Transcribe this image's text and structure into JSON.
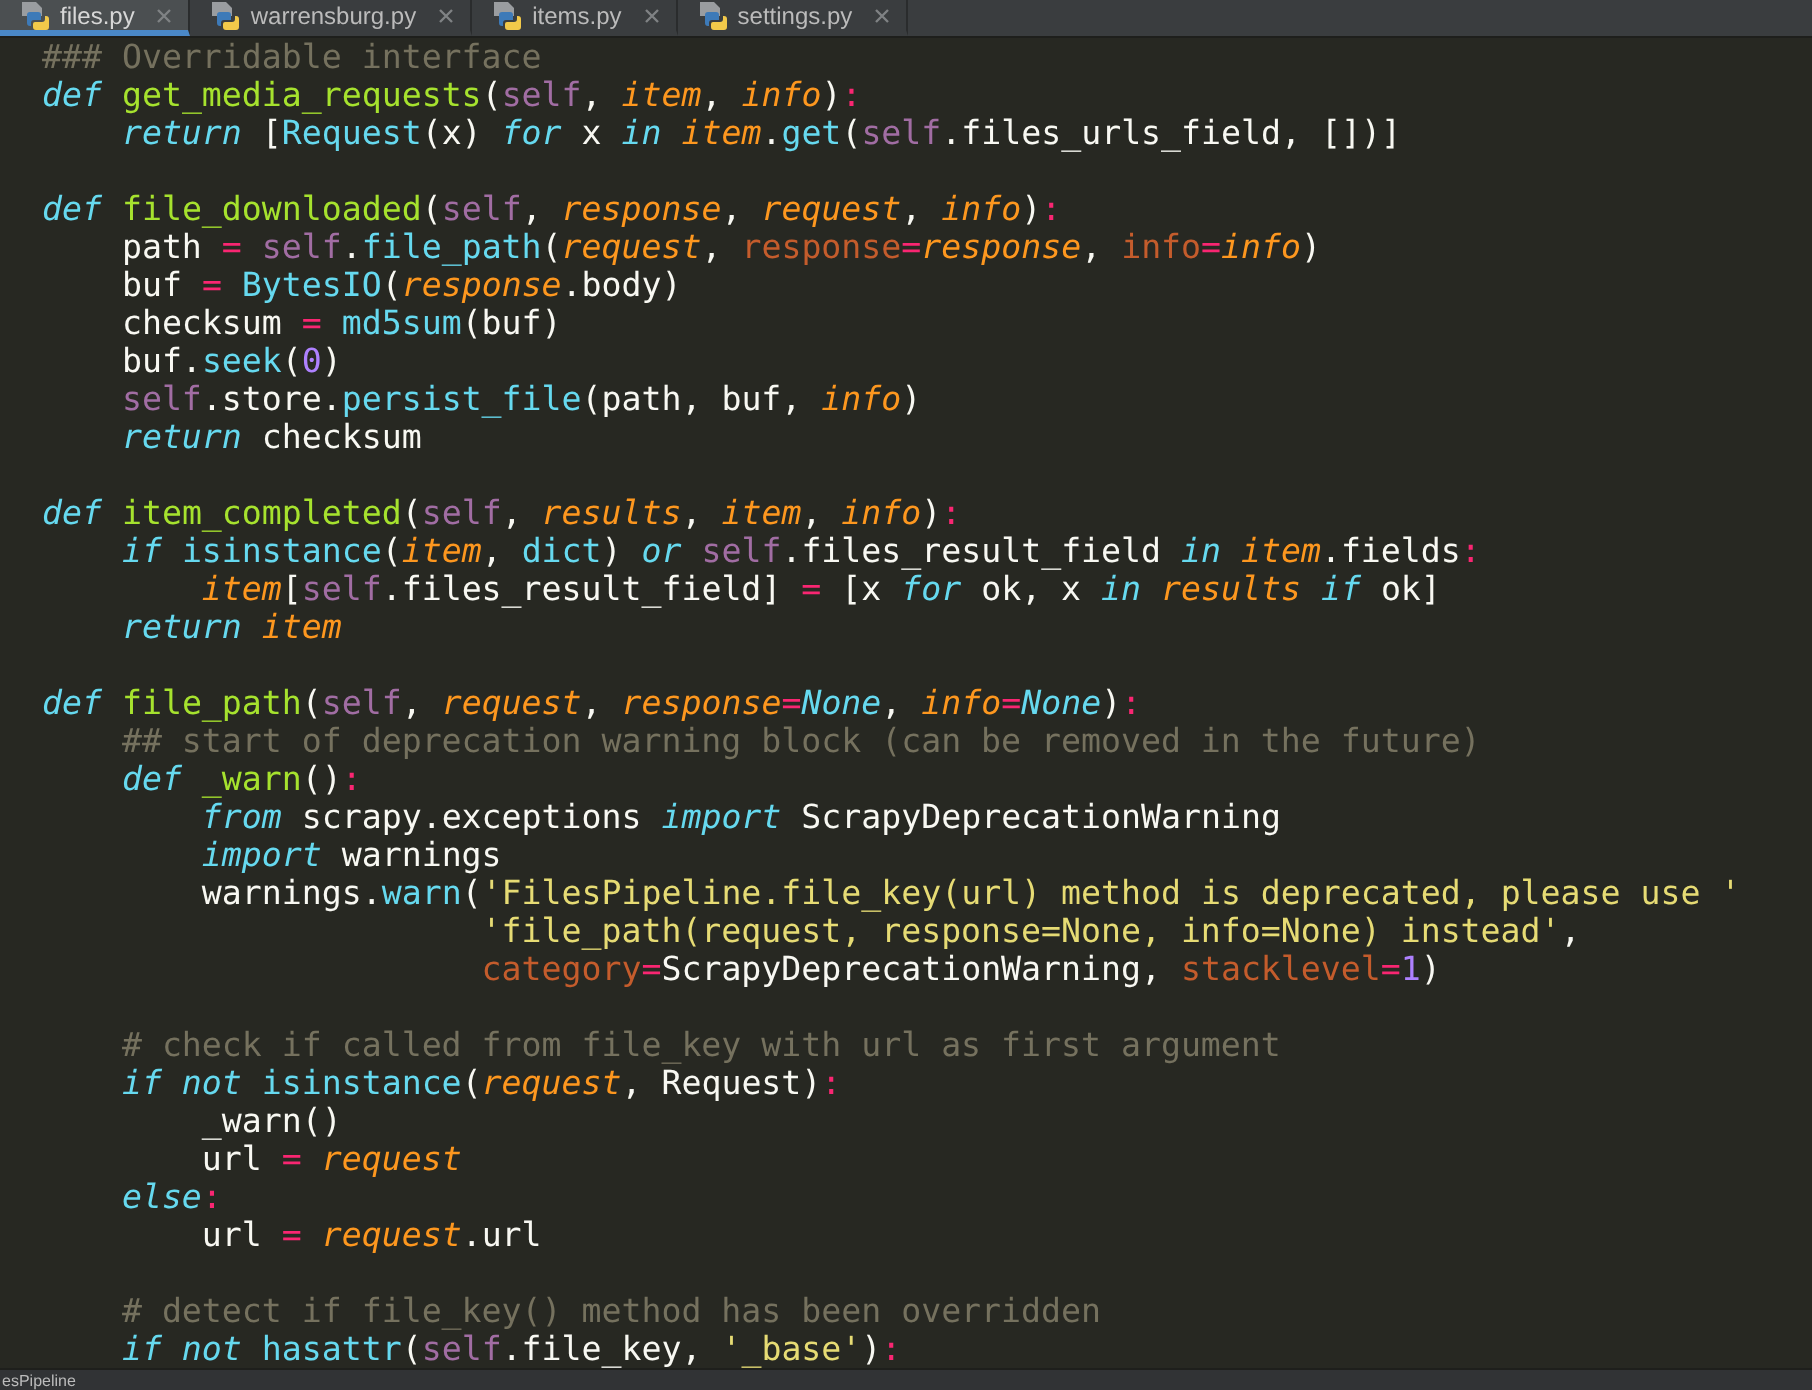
{
  "tabs": [
    {
      "label": "files.py",
      "selected": true
    },
    {
      "label": "warrensburg.py",
      "selected": false
    },
    {
      "label": "items.py",
      "selected": false
    },
    {
      "label": "settings.py",
      "selected": false
    }
  ],
  "code_lines": [
    {
      "kind": "code",
      "tokens": [
        {
          "kind": "comment",
          "text": "### Overridable interface"
        }
      ]
    },
    {
      "kind": "code",
      "tokens": [
        {
          "kind": "keyword",
          "text": "def"
        },
        {
          "kind": "function",
          "text": " get_media_requests"
        },
        {
          "kind": "plain",
          "text": "("
        },
        {
          "kind": "self",
          "text": "self"
        },
        {
          "kind": "plain",
          "text": ", "
        },
        {
          "kind": "param",
          "text": "item"
        },
        {
          "kind": "plain",
          "text": ", "
        },
        {
          "kind": "param",
          "text": "info"
        },
        {
          "kind": "plain",
          "text": ")"
        },
        {
          "kind": "operator",
          "text": ":"
        }
      ]
    },
    {
      "kind": "code",
      "tokens": [
        {
          "kind": "keyword",
          "text": "    return"
        },
        {
          "kind": "plain",
          "text": " ["
        },
        {
          "kind": "call",
          "text": "Request"
        },
        {
          "kind": "plain",
          "text": "(x) "
        },
        {
          "kind": "keyword",
          "text": "for"
        },
        {
          "kind": "plain",
          "text": " x "
        },
        {
          "kind": "keyword",
          "text": "in"
        },
        {
          "kind": "param",
          "text": " item"
        },
        {
          "kind": "plain",
          "text": "."
        },
        {
          "kind": "call",
          "text": "get"
        },
        {
          "kind": "plain",
          "text": "("
        },
        {
          "kind": "self",
          "text": "self"
        },
        {
          "kind": "plain",
          "text": ".files_urls_field, [])]"
        }
      ]
    },
    {
      "kind": "blank"
    },
    {
      "kind": "code",
      "tokens": [
        {
          "kind": "keyword",
          "text": "def"
        },
        {
          "kind": "function",
          "text": " file_downloaded"
        },
        {
          "kind": "plain",
          "text": "("
        },
        {
          "kind": "self",
          "text": "self"
        },
        {
          "kind": "plain",
          "text": ", "
        },
        {
          "kind": "param",
          "text": "response"
        },
        {
          "kind": "plain",
          "text": ", "
        },
        {
          "kind": "param",
          "text": "request"
        },
        {
          "kind": "plain",
          "text": ", "
        },
        {
          "kind": "param",
          "text": "info"
        },
        {
          "kind": "plain",
          "text": ")"
        },
        {
          "kind": "operator",
          "text": ":"
        }
      ]
    },
    {
      "kind": "code",
      "tokens": [
        {
          "kind": "plain",
          "text": "    path "
        },
        {
          "kind": "operator",
          "text": "="
        },
        {
          "kind": "self",
          "text": " self"
        },
        {
          "kind": "plain",
          "text": "."
        },
        {
          "kind": "call",
          "text": "file_path"
        },
        {
          "kind": "plain",
          "text": "("
        },
        {
          "kind": "param",
          "text": "request"
        },
        {
          "kind": "plain",
          "text": ", "
        },
        {
          "kind": "kwarg",
          "text": "response"
        },
        {
          "kind": "operator",
          "text": "="
        },
        {
          "kind": "param",
          "text": "response"
        },
        {
          "kind": "plain",
          "text": ", "
        },
        {
          "kind": "kwarg",
          "text": "info"
        },
        {
          "kind": "operator",
          "text": "="
        },
        {
          "kind": "param",
          "text": "info"
        },
        {
          "kind": "plain",
          "text": ")"
        }
      ]
    },
    {
      "kind": "code",
      "tokens": [
        {
          "kind": "plain",
          "text": "    buf "
        },
        {
          "kind": "operator",
          "text": "="
        },
        {
          "kind": "call",
          "text": " BytesIO"
        },
        {
          "kind": "plain",
          "text": "("
        },
        {
          "kind": "param",
          "text": "response"
        },
        {
          "kind": "plain",
          "text": ".body)"
        }
      ]
    },
    {
      "kind": "code",
      "tokens": [
        {
          "kind": "plain",
          "text": "    checksum "
        },
        {
          "kind": "operator",
          "text": "="
        },
        {
          "kind": "call",
          "text": " md5sum"
        },
        {
          "kind": "plain",
          "text": "(buf)"
        }
      ]
    },
    {
      "kind": "code",
      "tokens": [
        {
          "kind": "plain",
          "text": "    buf."
        },
        {
          "kind": "call",
          "text": "seek"
        },
        {
          "kind": "plain",
          "text": "("
        },
        {
          "kind": "number",
          "text": "0"
        },
        {
          "kind": "plain",
          "text": ")"
        }
      ]
    },
    {
      "kind": "code",
      "tokens": [
        {
          "kind": "self",
          "text": "    self"
        },
        {
          "kind": "plain",
          "text": ".store."
        },
        {
          "kind": "call",
          "text": "persist_file"
        },
        {
          "kind": "plain",
          "text": "(path, buf, "
        },
        {
          "kind": "param",
          "text": "info"
        },
        {
          "kind": "plain",
          "text": ")"
        }
      ]
    },
    {
      "kind": "code",
      "tokens": [
        {
          "kind": "keyword",
          "text": "    return"
        },
        {
          "kind": "plain",
          "text": " checksum"
        }
      ]
    },
    {
      "kind": "blank"
    },
    {
      "kind": "code",
      "tokens": [
        {
          "kind": "keyword",
          "text": "def"
        },
        {
          "kind": "function",
          "text": " item_completed"
        },
        {
          "kind": "plain",
          "text": "("
        },
        {
          "kind": "self",
          "text": "self"
        },
        {
          "kind": "plain",
          "text": ", "
        },
        {
          "kind": "param",
          "text": "results"
        },
        {
          "kind": "plain",
          "text": ", "
        },
        {
          "kind": "param",
          "text": "item"
        },
        {
          "kind": "plain",
          "text": ", "
        },
        {
          "kind": "param",
          "text": "info"
        },
        {
          "kind": "plain",
          "text": ")"
        },
        {
          "kind": "operator",
          "text": ":"
        }
      ]
    },
    {
      "kind": "code",
      "tokens": [
        {
          "kind": "keyword",
          "text": "    if"
        },
        {
          "kind": "call",
          "text": " isinstance"
        },
        {
          "kind": "plain",
          "text": "("
        },
        {
          "kind": "param",
          "text": "item"
        },
        {
          "kind": "plain",
          "text": ", "
        },
        {
          "kind": "call",
          "text": "dict"
        },
        {
          "kind": "plain",
          "text": ") "
        },
        {
          "kind": "keyword",
          "text": "or"
        },
        {
          "kind": "self",
          "text": " self"
        },
        {
          "kind": "plain",
          "text": ".files_result_field "
        },
        {
          "kind": "keyword",
          "text": "in"
        },
        {
          "kind": "param",
          "text": " item"
        },
        {
          "kind": "plain",
          "text": ".fields"
        },
        {
          "kind": "operator",
          "text": ":"
        }
      ]
    },
    {
      "kind": "code",
      "tokens": [
        {
          "kind": "param",
          "text": "        item"
        },
        {
          "kind": "plain",
          "text": "["
        },
        {
          "kind": "self",
          "text": "self"
        },
        {
          "kind": "plain",
          "text": ".files_result_field] "
        },
        {
          "kind": "operator",
          "text": "="
        },
        {
          "kind": "plain",
          "text": " [x "
        },
        {
          "kind": "keyword",
          "text": "for"
        },
        {
          "kind": "plain",
          "text": " ok, x "
        },
        {
          "kind": "keyword",
          "text": "in"
        },
        {
          "kind": "param",
          "text": " results"
        },
        {
          "kind": "keyword",
          "text": " if"
        },
        {
          "kind": "plain",
          "text": " ok]"
        }
      ]
    },
    {
      "kind": "code",
      "tokens": [
        {
          "kind": "keyword",
          "text": "    return"
        },
        {
          "kind": "param",
          "text": " item"
        }
      ]
    },
    {
      "kind": "blank"
    },
    {
      "kind": "code",
      "tokens": [
        {
          "kind": "keyword",
          "text": "def"
        },
        {
          "kind": "function",
          "text": " file_path"
        },
        {
          "kind": "plain",
          "text": "("
        },
        {
          "kind": "self",
          "text": "self"
        },
        {
          "kind": "plain",
          "text": ", "
        },
        {
          "kind": "param",
          "text": "request"
        },
        {
          "kind": "plain",
          "text": ", "
        },
        {
          "kind": "param",
          "text": "response"
        },
        {
          "kind": "operator",
          "text": "="
        },
        {
          "kind": "constant",
          "text": "None"
        },
        {
          "kind": "plain",
          "text": ", "
        },
        {
          "kind": "param",
          "text": "info"
        },
        {
          "kind": "operator",
          "text": "="
        },
        {
          "kind": "constant",
          "text": "None"
        },
        {
          "kind": "plain",
          "text": ")"
        },
        {
          "kind": "operator",
          "text": ":"
        }
      ]
    },
    {
      "kind": "code",
      "tokens": [
        {
          "kind": "comment",
          "text": "    ## start of deprecation warning block (can be removed in the future)"
        }
      ]
    },
    {
      "kind": "code",
      "tokens": [
        {
          "kind": "keyword",
          "text": "    def"
        },
        {
          "kind": "function",
          "text": " _warn"
        },
        {
          "kind": "plain",
          "text": "()"
        },
        {
          "kind": "operator",
          "text": ":"
        }
      ]
    },
    {
      "kind": "code",
      "tokens": [
        {
          "kind": "keyword",
          "text": "        from"
        },
        {
          "kind": "plain",
          "text": " scrapy.exceptions "
        },
        {
          "kind": "keyword",
          "text": "import"
        },
        {
          "kind": "plain",
          "text": " ScrapyDeprecationWarning"
        }
      ]
    },
    {
      "kind": "code",
      "tokens": [
        {
          "kind": "keyword",
          "text": "        import"
        },
        {
          "kind": "plain",
          "text": " warnings"
        }
      ]
    },
    {
      "kind": "code",
      "tokens": [
        {
          "kind": "plain",
          "text": "        warnings."
        },
        {
          "kind": "call",
          "text": "warn"
        },
        {
          "kind": "plain",
          "text": "("
        },
        {
          "kind": "string",
          "text": "'FilesPipeline.file_key(url) method is deprecated, please use '"
        }
      ]
    },
    {
      "kind": "code",
      "tokens": [
        {
          "kind": "string",
          "text": "                      'file_path(request, response=None, info=None) instead'"
        },
        {
          "kind": "plain",
          "text": ","
        }
      ]
    },
    {
      "kind": "code",
      "tokens": [
        {
          "kind": "kwarg",
          "text": "                      category"
        },
        {
          "kind": "operator",
          "text": "="
        },
        {
          "kind": "plain",
          "text": "ScrapyDeprecationWarning, "
        },
        {
          "kind": "kwarg",
          "text": "stacklevel"
        },
        {
          "kind": "operator",
          "text": "="
        },
        {
          "kind": "number",
          "text": "1"
        },
        {
          "kind": "plain",
          "text": ")"
        }
      ]
    },
    {
      "kind": "blank"
    },
    {
      "kind": "code",
      "tokens": [
        {
          "kind": "comment",
          "text": "    # check if called from file_key with url as first argument"
        }
      ]
    },
    {
      "kind": "code",
      "tokens": [
        {
          "kind": "keyword",
          "text": "    if not"
        },
        {
          "kind": "call",
          "text": " isinstance"
        },
        {
          "kind": "plain",
          "text": "("
        },
        {
          "kind": "param",
          "text": "request"
        },
        {
          "kind": "plain",
          "text": ", Request)"
        },
        {
          "kind": "operator",
          "text": ":"
        }
      ]
    },
    {
      "kind": "code",
      "tokens": [
        {
          "kind": "plain",
          "text": "        _warn()"
        }
      ]
    },
    {
      "kind": "code",
      "tokens": [
        {
          "kind": "plain",
          "text": "        url "
        },
        {
          "kind": "operator",
          "text": "="
        },
        {
          "kind": "param",
          "text": " request"
        }
      ]
    },
    {
      "kind": "code",
      "tokens": [
        {
          "kind": "keyword",
          "text": "    else"
        },
        {
          "kind": "operator",
          "text": ":"
        }
      ]
    },
    {
      "kind": "code",
      "tokens": [
        {
          "kind": "plain",
          "text": "        url "
        },
        {
          "kind": "operator",
          "text": "="
        },
        {
          "kind": "param",
          "text": " request"
        },
        {
          "kind": "plain",
          "text": ".url"
        }
      ]
    },
    {
      "kind": "blank"
    },
    {
      "kind": "code",
      "tokens": [
        {
          "kind": "comment",
          "text": "    # detect if file_key() method has been overridden"
        }
      ]
    },
    {
      "kind": "code",
      "tokens": [
        {
          "kind": "keyword",
          "text": "    if not"
        },
        {
          "kind": "call",
          "text": " hasattr"
        },
        {
          "kind": "plain",
          "text": "("
        },
        {
          "kind": "self",
          "text": "self"
        },
        {
          "kind": "plain",
          "text": ".file_key, "
        },
        {
          "kind": "string",
          "text": "'_base'"
        },
        {
          "kind": "plain",
          "text": ")"
        },
        {
          "kind": "operator",
          "text": ":"
        }
      ]
    }
  ],
  "breadcrumb": "esPipeline"
}
